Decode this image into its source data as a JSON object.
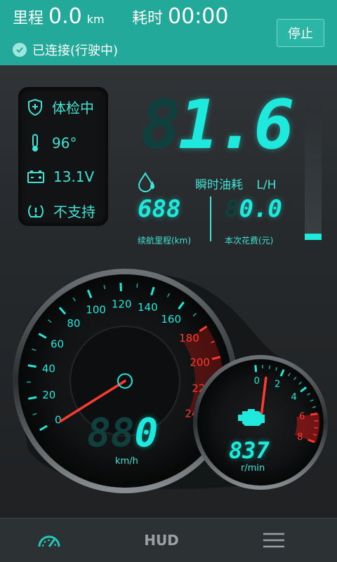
{
  "header": {
    "mileage_label": "里程",
    "mileage_value": "0.0",
    "mileage_unit": "km",
    "time_label": "耗时",
    "time_value": "00:00",
    "status_text": "已连接(行驶中)",
    "stop_label": "停止"
  },
  "side_panel": {
    "check_label": "体检中",
    "temperature": "96°",
    "voltage": "13.1V",
    "tpms_label": "不支持"
  },
  "fuel": {
    "big_value": "1.6",
    "big_ghost": "8",
    "instant_label": "瞬时油耗",
    "instant_unit": "L/H",
    "range_value": "688",
    "range_label": "续航里程(km)",
    "cost_value": "0.0",
    "cost_ghost": "8",
    "cost_label": "本次花费(元)",
    "level_fraction": 0.05
  },
  "speedometer": {
    "ticks": [
      "0",
      "20",
      "40",
      "60",
      "80",
      "100",
      "120",
      "140",
      "160",
      "180",
      "200",
      "220",
      "240"
    ],
    "red_from": 180,
    "max": 240,
    "speed_value": "0",
    "speed_ghost": "88",
    "unit": "km/h",
    "needle_value": 0
  },
  "tachometer": {
    "ticks": [
      "0",
      "2",
      "4",
      "6",
      "8"
    ],
    "red_from": 6,
    "max": 8,
    "rpm_value": "837",
    "unit": "r/min",
    "needle_value": 0.837
  },
  "nav": {
    "hud_label": "HUD"
  },
  "colors": {
    "accent": "#1ee9dc",
    "header": "#22a99a",
    "red": "#e0211c"
  }
}
